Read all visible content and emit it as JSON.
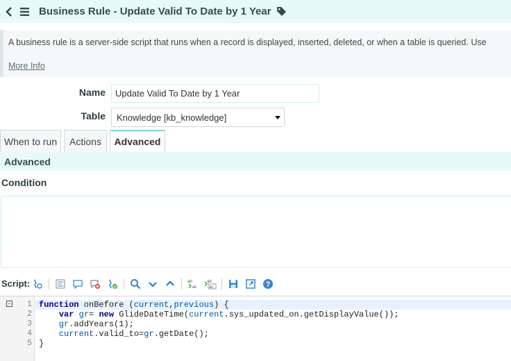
{
  "header": {
    "title": "Business Rule - Update Valid To Date by 1 Year"
  },
  "info": {
    "text": "A business rule is a server-side script that runs when a record is displayed, inserted, deleted, or when a table is queried. Use",
    "more_info": "More Info"
  },
  "form": {
    "name_label": "Name",
    "name_value": "Update Valid To Date by 1 Year",
    "table_label": "Table",
    "table_value": "Knowledge [kb_knowledge]"
  },
  "tabs": [
    {
      "label": "When to run",
      "active": false
    },
    {
      "label": "Actions",
      "active": false
    },
    {
      "label": "Advanced",
      "active": true
    }
  ],
  "section": {
    "title": "Advanced",
    "condition_label": "Condition",
    "condition_value": "",
    "script_label": "Script:"
  },
  "toolbar_icons": [
    "script-include-icon",
    "format-code-icon",
    "toggle-comment-icon",
    "syntax-check-icon",
    "script-debugger-icon",
    "search-icon",
    "find-next-icon",
    "find-previous-icon",
    "replace-icon",
    "replace-all-icon",
    "save-icon",
    "fullscreen-icon",
    "help-icon"
  ],
  "editor": {
    "line_numbers": [
      "1",
      "2",
      "3",
      "4",
      "5"
    ],
    "lines": [
      "function onBefore (current,previous) {",
      "    var gr= new GlideDateTime(current.sys_updated_on.getDisplayValue());",
      "    gr.addYears(1);",
      "    current.valid_to=gr.getDate();",
      "}"
    ]
  },
  "colors": {
    "header_bg": "#e6fbf7",
    "accent": "#81d8c7",
    "toolbar_icon": "#3a87c8"
  }
}
